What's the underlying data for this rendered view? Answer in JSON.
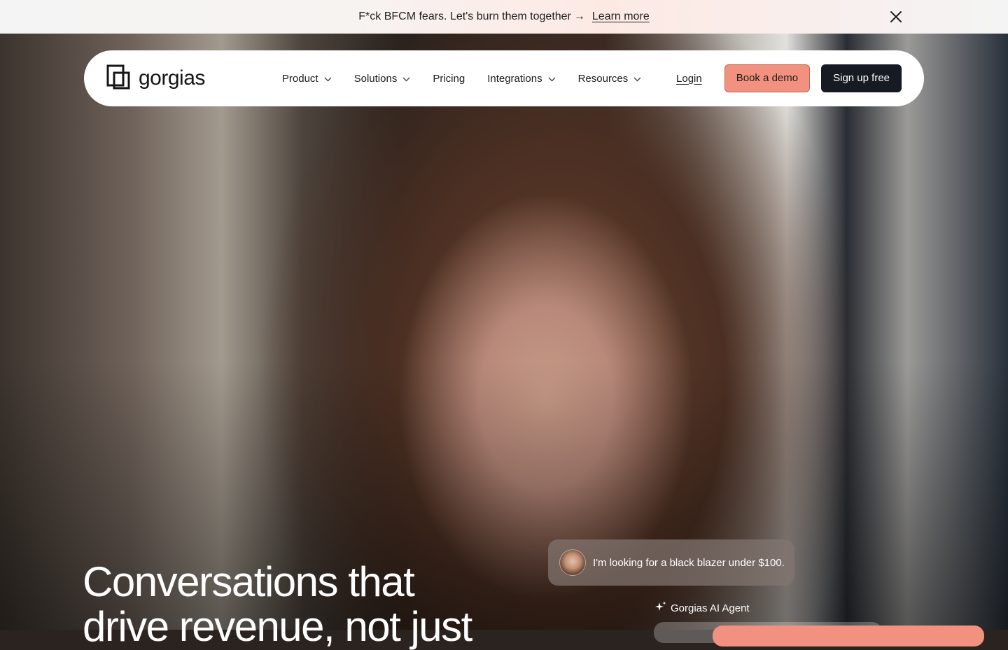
{
  "announcement": {
    "text": "F*ck BFCM fears. Let's burn them together",
    "arrow": "→",
    "link": "Learn more",
    "close_icon": "close-icon"
  },
  "nav": {
    "logo_text": "gorgias",
    "menu": [
      {
        "label": "Product",
        "dropdown": true
      },
      {
        "label": "Solutions",
        "dropdown": true
      },
      {
        "label": "Pricing",
        "dropdown": false
      },
      {
        "label": "Integrations",
        "dropdown": true
      },
      {
        "label": "Resources",
        "dropdown": true
      }
    ],
    "login": "Login",
    "book_demo": "Book a demo",
    "sign_up": "Sign up free"
  },
  "hero": {
    "headline_line1": "Conversations that",
    "headline_line2": "drive revenue, not just",
    "chat_message": "I'm looking for a black blazer under $100.",
    "agent_label": "Gorgias AI Agent"
  },
  "colors": {
    "accent": "#f2917f",
    "dark": "#161a22",
    "nav_bg": "#ffffff"
  }
}
